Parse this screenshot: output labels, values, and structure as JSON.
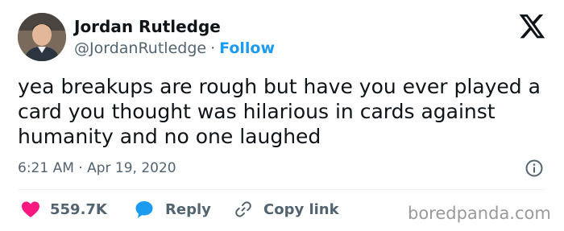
{
  "author": {
    "name": "Jordan Rutledge",
    "handle": "@JordanRutledge",
    "separator": "·",
    "follow_label": "Follow"
  },
  "tweet": {
    "text": "yea breakups are rough but have you ever played a card you thought was hilarious in cards against humanity and no one laughed",
    "time": "6:21 AM",
    "date_separator": "·",
    "date": "Apr 19, 2020"
  },
  "actions": {
    "like_count": "559.7K",
    "reply_label": "Reply",
    "copy_label": "Copy link"
  },
  "watermark": "boredpanda.com",
  "icons": {
    "like": "heart-icon",
    "reply": "speech-bubble-icon",
    "copy": "link-icon",
    "info": "info-icon",
    "brand": "x-logo-icon"
  },
  "colors": {
    "text": "#0f1419",
    "secondary": "#536471",
    "accent": "#1d9bf0",
    "like": "#f91880",
    "watermark": "#9a9a9a"
  }
}
